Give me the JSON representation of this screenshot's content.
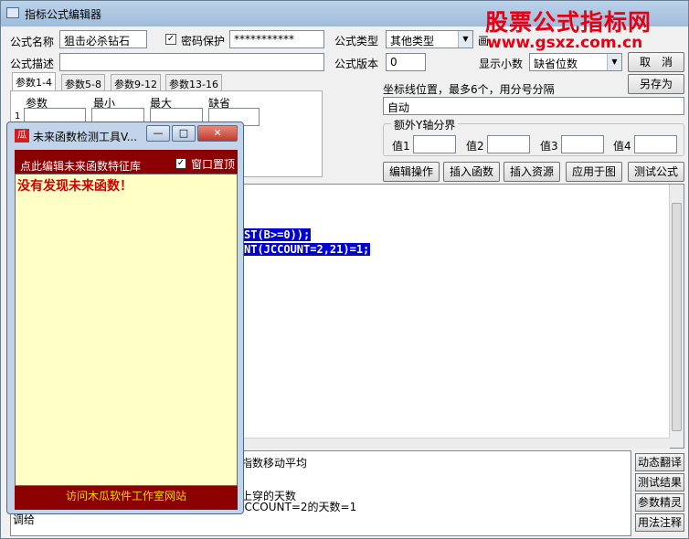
{
  "window": {
    "title": "指标公式编辑器"
  },
  "watermark": {
    "brand": "股票公式指标网",
    "url": "www.gsxz.com.cn"
  },
  "form": {
    "name_label": "公式名称",
    "name_value": "狙击必杀钻石",
    "password_label": "密码保护",
    "password_value": "***********",
    "type_label": "公式类型",
    "type_value": "其他类型",
    "desc_label": "公式描述",
    "desc_value": "",
    "version_label": "公式版本",
    "version_value": "0",
    "decimals_label": "显示小数",
    "decimals_value": "缺省位数",
    "cancel_label": "取　消",
    "saveas_label": "另存为",
    "partial_label": "画"
  },
  "params": {
    "tabs": [
      "参数1-4",
      "参数5-8",
      "参数9-12",
      "参数13-16"
    ],
    "headers": [
      "参数",
      "最小",
      "最大",
      "缺省"
    ],
    "row_index": "1"
  },
  "axis": {
    "label": "坐标线位置，最多6个，用分号分隔",
    "value": "自动",
    "group_title": "额外Y轴分界",
    "val_labels": [
      "值1",
      "值2",
      "值3",
      "值4"
    ]
  },
  "actions": [
    "编辑操作",
    "插入函数",
    "插入资源",
    "应用于图",
    "测试公式"
  ],
  "editor": {
    "lines": [
      "ST(B>=0));",
      "NT(JCCOUNT=2,21)=1;"
    ]
  },
  "bottom": {
    "lines": [
      "指数移动平均",
      "上穿的天数",
      "JCCOUNT=2的天数=1",
      "调给"
    ]
  },
  "side_buttons": [
    "动态翻译",
    "测试结果",
    "参数精灵",
    "用法注释"
  ],
  "popup": {
    "title": "未来函数检测工具V...",
    "icon_text": "瓜",
    "link_label": "点此编辑未来函数特征库",
    "topmost_label": "窗口置顶",
    "result": "没有发现未来函数！",
    "footer": "访问木瓜软件工作室网站",
    "btn_min": "—",
    "btn_max": "□",
    "btn_close": "✕"
  }
}
